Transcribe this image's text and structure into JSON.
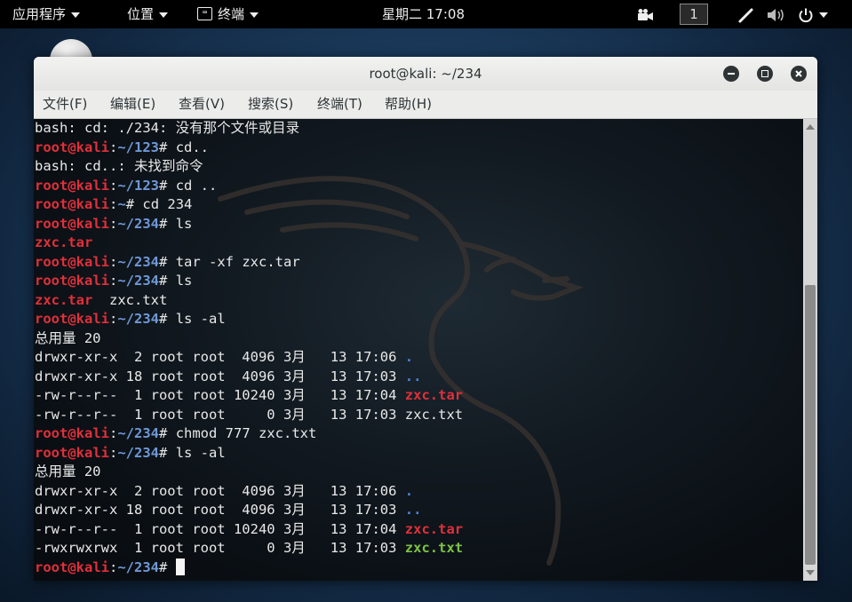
{
  "topbar": {
    "apps_menu": "应用程序",
    "places_menu": "位置",
    "terminal_menu": "终端",
    "terminal_icon_glyph": "⌨",
    "clock": "星期二 17:08",
    "workspace": "1",
    "icons": [
      "camera-icon",
      "pen-icon",
      "volume-icon",
      "power-icon"
    ]
  },
  "window": {
    "title": "root@kali: ~/234",
    "buttons": [
      "minimize-icon",
      "maximize-icon",
      "close-icon"
    ],
    "menu": [
      "文件(F)",
      "编辑(E)",
      "查看(V)",
      "搜索(S)",
      "终端(T)",
      "帮助(H)"
    ]
  },
  "terminal": {
    "colors": {
      "prompt_user": "#e0303a",
      "prompt_path": "#6f98d6",
      "text": "#e8e8e8",
      "dir": "#4e86d8",
      "archive": "#e0303a",
      "executable": "#7ec244"
    },
    "lines": [
      {
        "type": "text",
        "text": "bash: cd: ./234: 没有那个文件或目录"
      },
      {
        "type": "prompt",
        "user": "root@kali",
        "path": "~/123",
        "cmd": " cd.."
      },
      {
        "type": "text",
        "text": "bash: cd..: 未找到命令"
      },
      {
        "type": "prompt",
        "user": "root@kali",
        "path": "~/123",
        "cmd": " cd .."
      },
      {
        "type": "prompt",
        "user": "root@kali",
        "path": "~",
        "cmd": " cd 234"
      },
      {
        "type": "prompt",
        "user": "root@kali",
        "path": "~/234",
        "cmd": " ls"
      },
      {
        "type": "files",
        "files": [
          {
            "name": "zxc.tar",
            "color": "red"
          }
        ]
      },
      {
        "type": "prompt",
        "user": "root@kali",
        "path": "~/234",
        "cmd": " tar -xf zxc.tar"
      },
      {
        "type": "prompt",
        "user": "root@kali",
        "path": "~/234",
        "cmd": " ls"
      },
      {
        "type": "files",
        "files": [
          {
            "name": "zxc.tar",
            "color": "red"
          },
          {
            "name": "zxc.txt",
            "color": "plain"
          }
        ]
      },
      {
        "type": "prompt",
        "user": "root@kali",
        "path": "~/234",
        "cmd": " ls -al"
      },
      {
        "type": "text",
        "text": "总用量 20"
      },
      {
        "type": "listing",
        "info": "drwxr-xr-x  2 root root  4096 3月   13 17:06 ",
        "name": ".",
        "color": "blue"
      },
      {
        "type": "listing",
        "info": "drwxr-xr-x 18 root root  4096 3月   13 17:03 ",
        "name": "..",
        "color": "blue"
      },
      {
        "type": "listing",
        "info": "-rw-r--r--  1 root root 10240 3月   13 17:04 ",
        "name": "zxc.tar",
        "color": "red"
      },
      {
        "type": "listing",
        "info": "-rw-r--r--  1 root root     0 3月   13 17:03 ",
        "name": "zxc.txt",
        "color": "plain"
      },
      {
        "type": "prompt",
        "user": "root@kali",
        "path": "~/234",
        "cmd": " chmod 777 zxc.txt"
      },
      {
        "type": "prompt",
        "user": "root@kali",
        "path": "~/234",
        "cmd": " ls -al"
      },
      {
        "type": "text",
        "text": "总用量 20"
      },
      {
        "type": "listing",
        "info": "drwxr-xr-x  2 root root  4096 3月   13 17:06 ",
        "name": ".",
        "color": "blue"
      },
      {
        "type": "listing",
        "info": "drwxr-xr-x 18 root root  4096 3月   13 17:03 ",
        "name": "..",
        "color": "blue"
      },
      {
        "type": "listing",
        "info": "-rw-r--r--  1 root root 10240 3月   13 17:04 ",
        "name": "zxc.tar",
        "color": "red"
      },
      {
        "type": "listing",
        "info": "-rwxrwxrwx  1 root root     0 3月   13 17:03 ",
        "name": "zxc.txt",
        "color": "green"
      },
      {
        "type": "prompt",
        "user": "root@kali",
        "path": "~/234",
        "cmd": " ",
        "cursor": true
      }
    ]
  }
}
